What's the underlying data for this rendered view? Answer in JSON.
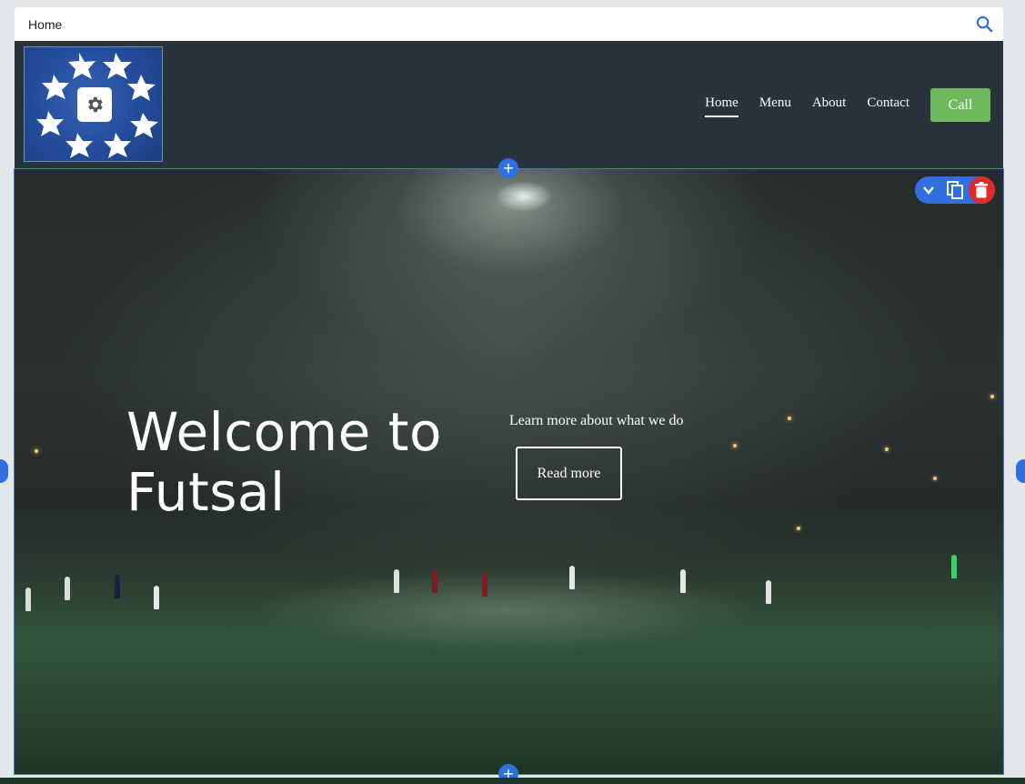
{
  "topbar": {
    "page_name": "Home",
    "search_icon": "search-icon"
  },
  "header": {
    "logo_alt": "stars-ball-logo",
    "settings_icon": "gear-icon",
    "nav": [
      {
        "label": "Home",
        "active": true
      },
      {
        "label": "Menu",
        "active": false
      },
      {
        "label": "About",
        "active": false
      },
      {
        "label": "Contact",
        "active": false
      }
    ],
    "call_label": "Call",
    "call_color": "#6fb85e"
  },
  "hero": {
    "title": "Welcome to Futsal",
    "subtitle": "Learn more about what we do",
    "button_label": "Read more",
    "toolbar": {
      "collapse_icon": "chevron-down-icon",
      "duplicate_icon": "copy-icon",
      "delete_icon": "trash-icon"
    },
    "add_section_label": "+"
  },
  "colors": {
    "accent": "#2f6fe0",
    "delete": "#e02a2a",
    "header_bg": "#28333c"
  }
}
